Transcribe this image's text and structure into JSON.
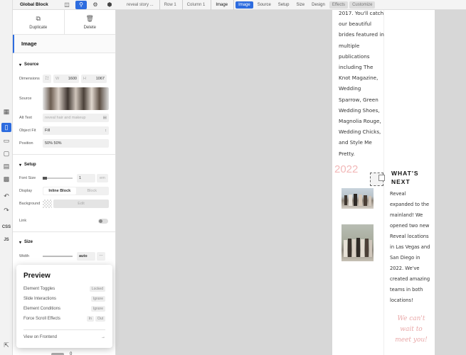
{
  "toolbar": {
    "title": "Global Block",
    "breadcrumbs": [
      "reveal story ...",
      "Row 1",
      "Column 1",
      "Image"
    ],
    "tabs": [
      "Image",
      "Source",
      "Setup",
      "Size",
      "Design",
      "Effects",
      "Customize"
    ]
  },
  "panel": {
    "duplicate": "Duplicate",
    "delete": "Delete",
    "element_title": "Image",
    "source": {
      "heading": "Source",
      "dimensions_label": "Dimensions",
      "w_label": "W",
      "w_value": "1600",
      "h_label": "H",
      "h_value": "1067",
      "source_label": "Source",
      "alt_label": "Alt Text",
      "alt_placeholder": "reveal hair and makeup",
      "fit_label": "Object Fit",
      "fit_value": "Fill",
      "position_label": "Position",
      "position_value": "50% 50%"
    },
    "setup": {
      "heading": "Setup",
      "font_size_label": "Font Size",
      "font_size_value": "1",
      "font_size_unit": "em",
      "display_label": "Display",
      "display_options": [
        "Inline Block",
        "Block"
      ],
      "background_label": "Background",
      "background_edit": "Edit",
      "link_label": "Link"
    },
    "size": {
      "heading": "Size",
      "width_label": "Width",
      "width_value": "auto",
      "bottom_value": "0"
    }
  },
  "preview": {
    "title": "Preview",
    "rows": [
      {
        "label": "Element Toggles",
        "value": "Locked"
      },
      {
        "label": "Slide Interactions",
        "value": "Ignore"
      },
      {
        "label": "Element Conditions",
        "value": "Ignore"
      },
      {
        "label": "Force Scroll Effects",
        "value_in": "In",
        "value_out": "Out"
      }
    ],
    "view_frontend": "View on Frontend"
  },
  "rail": {
    "css": "CSS",
    "js": "JS"
  },
  "canvas": {
    "story_lines": [
      "2017. You'll catch",
      "our beautiful",
      "brides featured in",
      "multiple",
      "publications",
      "including The",
      "Knot Magazine,",
      "Wedding",
      "Sparrow, Green",
      "Wedding Shoes,",
      "Magnolia Rouge,",
      "Wedding Chicks,",
      "and Style Me",
      "Pretty."
    ],
    "year": "2022",
    "next_title_lines": [
      "WHAT'S",
      "NEXT"
    ],
    "next_body_lines": [
      "Reveal",
      "expanded to the",
      "mainland! We",
      "opened two new",
      "Reveal locations",
      "in Las Vegas and",
      "San Diego in",
      "2022. We've",
      "created amazing",
      "teams in both",
      "locations!"
    ],
    "script_lines": [
      "We can't",
      "wait to",
      "meet you!"
    ]
  },
  "colors": {
    "accent": "#2d6cdf",
    "pink": "#f2b8b8"
  }
}
